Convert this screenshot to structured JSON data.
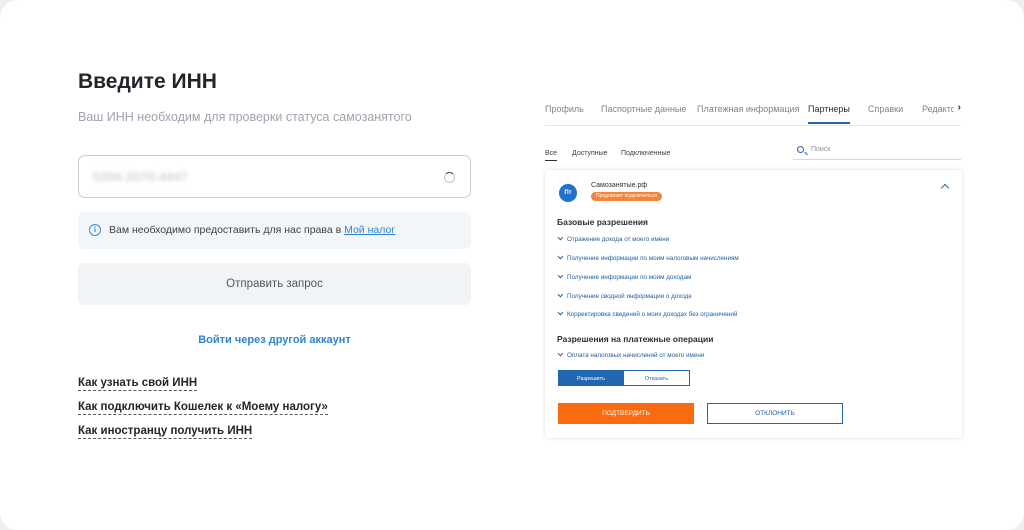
{
  "form": {
    "title": "Введите ИНН",
    "subtitle": "Ваш ИНН необходим для проверки статуса самозанятого",
    "inn_value": "0204-2070-4447",
    "info_text": "Вам необходимо предоставить для нас права в ",
    "info_link": "Мой налог",
    "send_label": "Отправить запрос",
    "other_account": "Войти через другой аккаунт",
    "help_links": [
      "Как узнать свой ИНН",
      "Как подключить Кошелек к «Моему налогу»",
      "Как иностранцу получить ИНН"
    ]
  },
  "panel": {
    "tabs": [
      "Профиль",
      "Паспортные данные",
      "Платежная информация",
      "Партнеры",
      "Справки",
      "Редакто"
    ],
    "active_tab": "Партнеры",
    "subtabs": [
      "Все",
      "Доступные",
      "Подключенные"
    ],
    "search_placeholder": "Поиск",
    "partner": {
      "logo_text": "Пт",
      "name": "Самозанятые.рф",
      "badge": "Предлагает подключиться",
      "sections": [
        {
          "title": "Базовые разрешения",
          "items": [
            "Отражение дохода от моего имени",
            "Получение информации по моим налоговым начислениям",
            "Получение информации по моим доходам",
            "Получение сводной информации о доходе",
            "Корректировка сведений о моих доходах без ограничений"
          ]
        },
        {
          "title": "Разрешения на платежные операции",
          "items": [
            "Оплата налоговых начислений от моего имени"
          ]
        }
      ],
      "allow_label": "Разрешить",
      "deny_label": "Отказать",
      "confirm_label": "ПОДТВЕРДИТЬ",
      "decline_label": "ОТКЛОНИТЬ"
    }
  },
  "colors": {
    "accent_blue": "#2d83d3",
    "accent_orange": "#fb6a0f",
    "badge_orange": "#f5833a",
    "dark_blue": "#1f67b0"
  }
}
